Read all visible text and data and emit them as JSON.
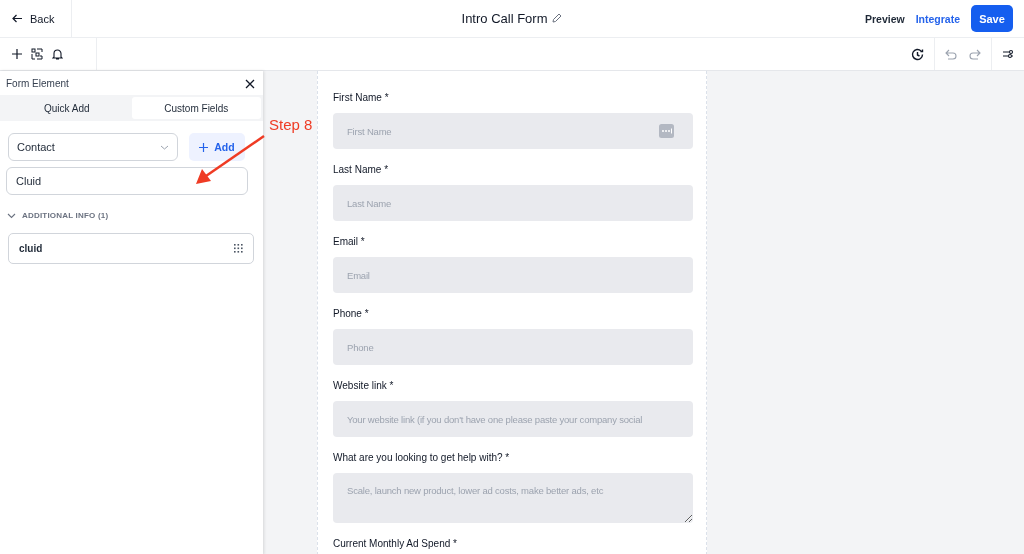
{
  "header": {
    "back": "Back",
    "title": "Intro Call Form",
    "preview": "Preview",
    "integrate": "Integrate",
    "save": "Save"
  },
  "panel": {
    "title": "Form Element",
    "tabs": [
      {
        "label": "Quick Add",
        "selected": false
      },
      {
        "label": "Custom Fields",
        "selected": true
      }
    ],
    "object_select": {
      "value": "Contact"
    },
    "add_button": "Add",
    "search": {
      "value": "Cluid"
    },
    "section": {
      "label": "ADDITIONAL INFO (1)",
      "expanded": true,
      "items": [
        {
          "label": "cluid"
        }
      ]
    }
  },
  "annotation": {
    "text": "Step 8"
  },
  "form": {
    "fields": [
      {
        "kind": "input",
        "label": "First Name *",
        "placeholder": "First Name",
        "autofill": true
      },
      {
        "kind": "input",
        "label": "Last Name *",
        "placeholder": "Last Name",
        "autofill": false
      },
      {
        "kind": "input",
        "label": "Email *",
        "placeholder": "Email",
        "autofill": false
      },
      {
        "kind": "input",
        "label": "Phone *",
        "placeholder": "Phone",
        "autofill": false
      },
      {
        "kind": "input",
        "label": "Website link *",
        "placeholder": "Your website link (if you don't have one please paste your company social",
        "autofill": false
      },
      {
        "kind": "textarea",
        "label": "What are you looking to get help with? *",
        "placeholder": "Scale, launch new product, lower ad costs, make better ads, etc"
      },
      {
        "kind": "label_only",
        "label": "Current Monthly Ad Spend *"
      }
    ]
  }
}
